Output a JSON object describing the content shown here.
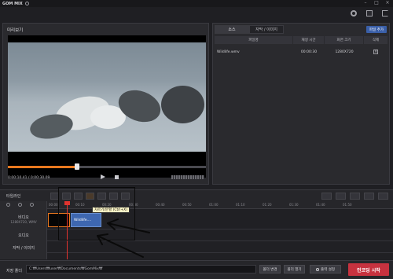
{
  "app": {
    "title": "GOM MIX"
  },
  "preview": {
    "title": "미리보기",
    "time": "0:00:10.41 / 0:00:30.09",
    "seek_progress": 0.35
  },
  "source_panel": {
    "tabs": [
      {
        "label": "소스"
      },
      {
        "label": "자막 / 이미지"
      }
    ],
    "add_file_label": "파일 추가",
    "columns": [
      "파일명",
      "재생 시간",
      "화면 크기",
      "삭제"
    ],
    "rows": [
      {
        "file": "Wildlife.wmv",
        "duration": "00:00:30",
        "size": "1280X720"
      }
    ]
  },
  "timeline": {
    "label": "타임라인",
    "ruler_ticks": [
      "00:00",
      "00:10",
      "00:20",
      "00:30",
      "00:40",
      "00:50",
      "01:00",
      "01:10",
      "01:20",
      "01:30",
      "01:40",
      "01:50"
    ],
    "tracks": {
      "video_label": "비디오",
      "video_sub": "1280X720, WMV",
      "audio_label": "오디오",
      "text_label": "자막 / 이미지"
    },
    "clip_label": "Wildlife....",
    "tooltip": "자르기/분할 (Ctrl+X)"
  },
  "bottom": {
    "save_label": "저장 폴더",
    "path": "C:₩Users₩user₩Documents₩GomMix₩",
    "change_folder": "폴더 변경",
    "open_folder": "폴더 열기",
    "output_settings": "출력 설정",
    "start": "인코딩 시작"
  }
}
